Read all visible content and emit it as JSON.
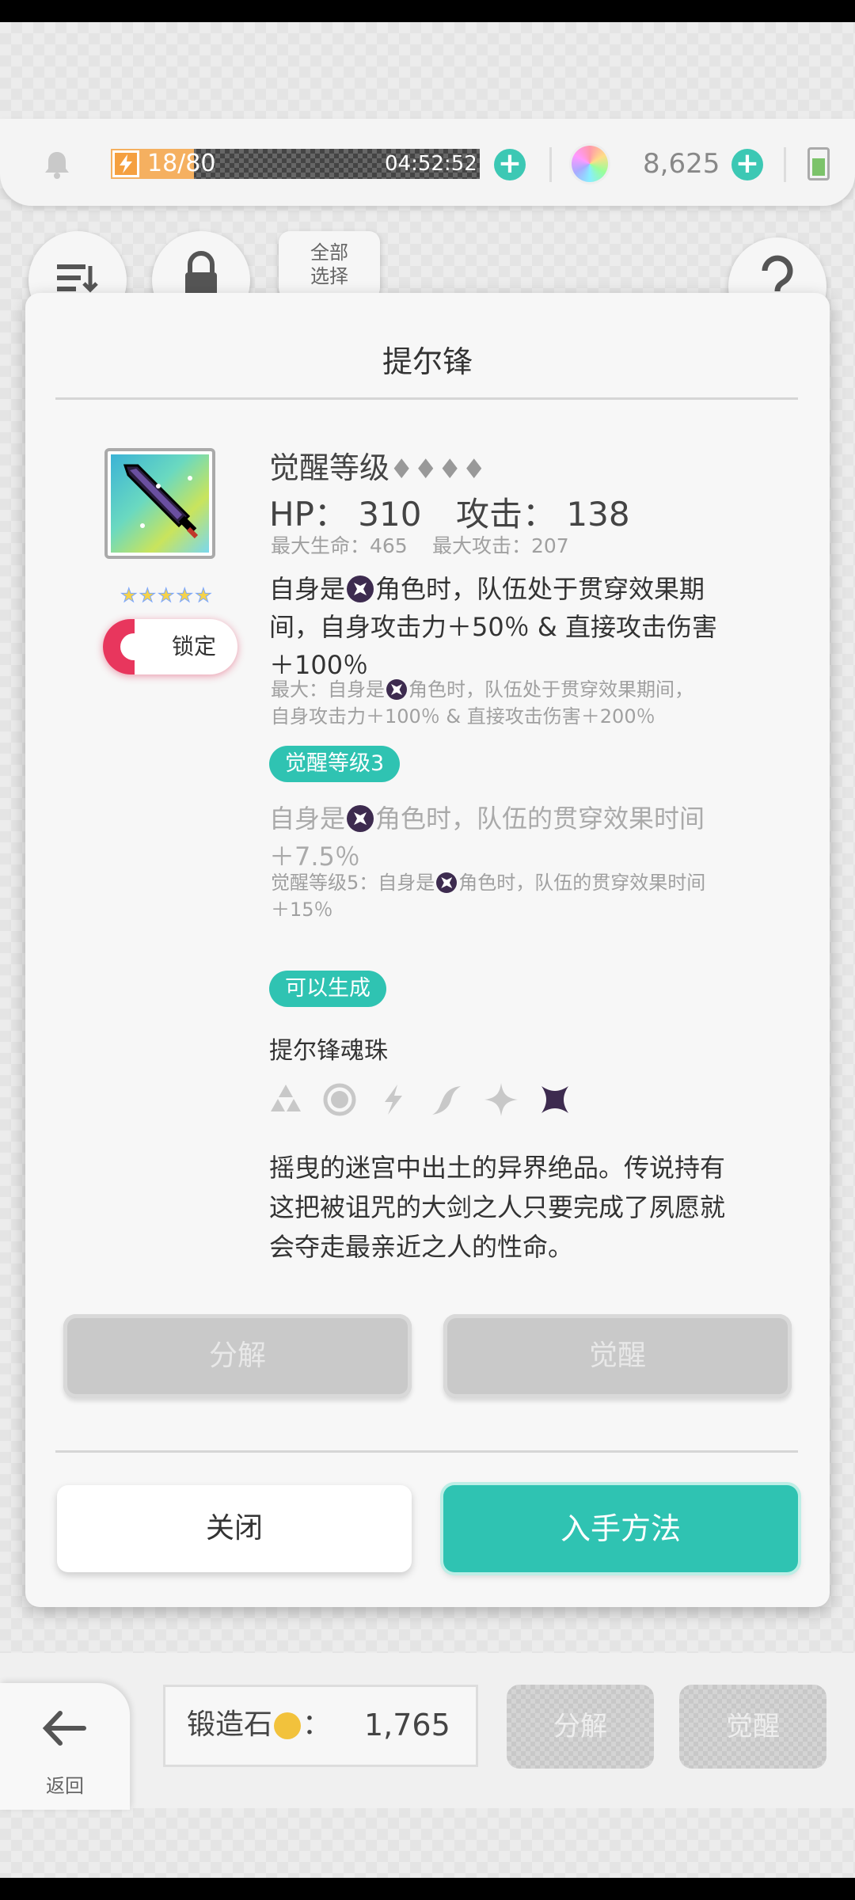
{
  "header": {
    "stamina": {
      "current": 18,
      "max": 80,
      "text": "18/80",
      "timer": "04:52:52"
    },
    "gems": "8,625"
  },
  "toolbar": {
    "select_all_label": "全部\n选择"
  },
  "modal": {
    "title": "提尔锋",
    "lock_label": "锁定",
    "rarity_stars": 5,
    "awaken_title": "觉醒等级",
    "awaken_diamonds": "♦♦♦♦",
    "hp_label": "HP：",
    "hp_value": "310",
    "atk_label": "攻击：",
    "atk_value": "138",
    "max_hp": "最大生命：465",
    "max_atk": "最大攻击：207",
    "skill1": {
      "pre": "自身是",
      "line1_rest": "角色时，队伍处于贯穿效果期",
      "line2": "间，自身攻击力＋50％ & 直接攻击伤害",
      "line3": "＋100％",
      "max_pre": "最大：自身是",
      "max_line1_rest": "角色时，队伍处于贯穿效果期间，",
      "max_line2": "自身攻击力＋100％ & 直接攻击伤害＋200％"
    },
    "badge_awaken3": "觉醒等级3",
    "skill2": {
      "pre": "自身是",
      "line1_rest": "角色时，队伍的贯穿效果时间",
      "line2": "＋7.5％",
      "max_pre": "觉醒等级5：自身是",
      "max_line1_rest": "角色时，队伍的贯穿效果时间",
      "max_line2": "＋15％"
    },
    "badge_craftable": "可以生成",
    "soul_orb": "提尔锋魂珠",
    "description": [
      "摇曳的迷宫中出土的异界绝品。传说持有",
      "这把被诅咒的大剑之人只要完成了夙愿就",
      "会夺走最亲近之人的性命。"
    ],
    "dismantle_label": "分解",
    "awaken_label": "觉醒",
    "close_label": "关闭",
    "obtain_label": "入手方法"
  },
  "footer": {
    "back_label": "返回",
    "forge_label": "锻造石",
    "forge_colon": "：",
    "forge_value": "1,765",
    "dismantle_label": "分解",
    "awaken_label": "觉醒"
  },
  "colors": {
    "accent": "#2fc3b2",
    "stamina": "#f5b060",
    "element_dark": "#3d2b4f",
    "element_inactive": "#c8c8c8"
  },
  "icons": [
    "bell-icon",
    "lightning-icon",
    "plus-icon",
    "rainbow-gem-icon",
    "battery-icon",
    "sort-icon",
    "lock-icon",
    "help-icon",
    "sword-icon",
    "star-icon",
    "element-water-icon",
    "element-circle-icon",
    "element-lightning-icon",
    "element-wind-icon",
    "element-light-icon",
    "element-dark-icon",
    "back-arrow-icon",
    "forge-stone-icon"
  ]
}
